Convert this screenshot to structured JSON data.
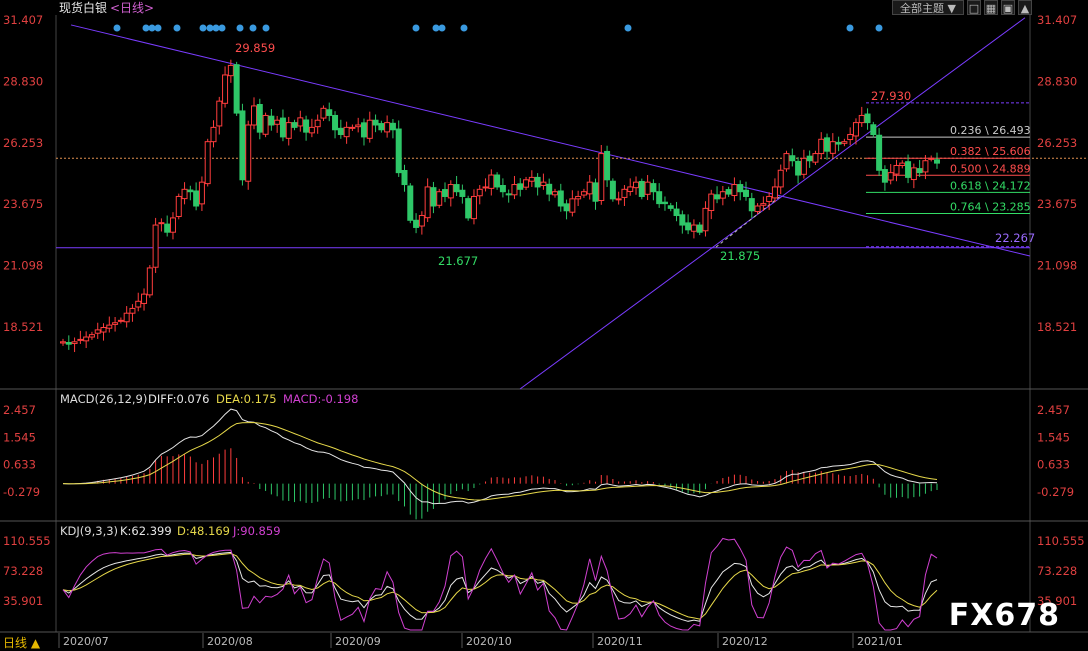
{
  "header": {
    "title": "现货白银",
    "period": "<日线>"
  },
  "toolbar": {
    "theme_select": "全部主题 ▼"
  },
  "watermark": "FX678",
  "footer": {
    "period_select": "日线 ▲"
  },
  "colors": {
    "up": "#ff3d3d",
    "down": "#2ec768",
    "trend": "#7a3cff",
    "dash": "#e09050",
    "blue": "#3a9ae0"
  },
  "price_ticks": [
    "31.407",
    "28.830",
    "26.253",
    "23.675",
    "21.098",
    "18.521"
  ],
  "macd_ticks": [
    "2.457",
    "1.545",
    "0.633",
    "-0.279"
  ],
  "kdj_ticks": [
    "110.555",
    "73.228",
    "35.901"
  ],
  "x_labels": [
    "2020/07",
    "2020/08",
    "2020/09",
    "2020/10",
    "2020/11",
    "2020/12",
    "2021/01"
  ],
  "annotations": {
    "high": "29.859",
    "low1": "21.677",
    "low2": "21.875",
    "high2": "27.930",
    "hline": "22.267"
  },
  "fib_levels": [
    {
      "label": "0.236 \\ 26.493",
      "value": 26.493,
      "color": "#c8c8c8"
    },
    {
      "label": "0.382 \\ 25.606",
      "value": 25.606,
      "color": "#ff4d4d"
    },
    {
      "label": "0.500 \\ 24.889",
      "value": 24.889,
      "color": "#ff4d4d"
    },
    {
      "label": "0.618 \\ 24.172",
      "value": 24.172,
      "color": "#33dd66"
    },
    {
      "label": "0.764 \\ 23.285",
      "value": 23.285,
      "color": "#33dd66"
    }
  ],
  "macd_legend": {
    "name": "MACD(26,12,9)",
    "diff": "DIFF:0.076",
    "dea": "DEA:0.175",
    "macd": "MACD:-0.198"
  },
  "kdj_legend": {
    "name": "KDJ(9,3,3)",
    "k": "K:62.399",
    "d": "D:48.169",
    "j": "J:90.859"
  },
  "chart_data": {
    "type": "candlestick",
    "title": "现货白银",
    "price_axis": [
      18.521,
      31.407
    ],
    "dates_start": "2020/06/26",
    "closes": [
      17.9,
      17.8,
      17.9,
      18.0,
      18.1,
      18.2,
      18.4,
      18.5,
      18.6,
      18.7,
      18.8,
      19.1,
      19.3,
      19.6,
      19.9,
      21.0,
      22.8,
      22.9,
      22.5,
      23.1,
      24.0,
      24.3,
      24.2,
      23.6,
      24.6,
      26.3,
      26.9,
      28.0,
      29.1,
      29.5,
      27.5,
      24.7,
      27.0,
      27.8,
      26.7,
      27.4,
      27.0,
      27.2,
      26.5,
      27.1,
      26.9,
      27.3,
      26.7,
      26.9,
      27.2,
      27.7,
      27.4,
      26.8,
      26.6,
      26.9,
      26.9,
      27.0,
      26.5,
      27.2,
      27.0,
      26.8,
      27.1,
      26.8,
      25.0,
      24.5,
      23.0,
      22.7,
      23.2,
      24.4,
      23.6,
      24.2,
      24.0,
      24.5,
      24.2,
      24.0,
      23.1,
      24.0,
      24.3,
      24.4,
      24.9,
      24.4,
      24.2,
      24.1,
      24.5,
      24.3,
      24.7,
      24.8,
      24.4,
      24.6,
      24.1,
      24.2,
      23.6,
      23.4,
      23.9,
      24.0,
      24.2,
      24.6,
      23.8,
      25.8,
      24.7,
      23.9,
      23.9,
      24.3,
      24.4,
      24.6,
      24.0,
      24.6,
      24.2,
      23.7,
      23.7,
      23.5,
      23.2,
      22.8,
      22.6,
      22.8,
      22.5,
      23.5,
      24.1,
      23.9,
      24.2,
      24.1,
      24.5,
      24.2,
      24.0,
      23.4,
      23.6,
      23.7,
      24.0,
      24.4,
      25.1,
      25.8,
      25.5,
      24.9,
      25.6,
      25.5,
      25.8,
      26.4,
      25.9,
      26.3,
      26.2,
      26.3,
      26.6,
      27.1,
      27.4,
      27.1,
      26.6,
      25.1,
      24.6,
      25.0,
      25.3,
      25.4,
      24.8,
      25.2,
      25.0,
      25.5,
      25.6,
      25.4
    ]
  }
}
